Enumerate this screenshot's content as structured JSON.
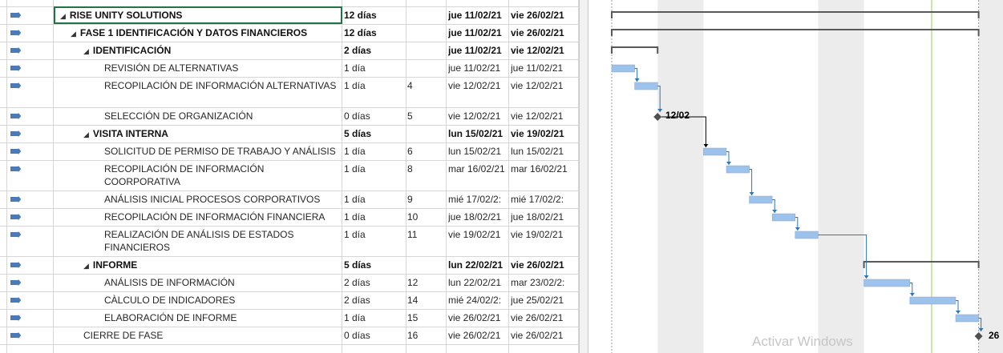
{
  "tasks": [
    {
      "name": "RISE UNITY SOLUTIONS",
      "dur": "12 días",
      "pred": "",
      "start": "jue 11/02/21",
      "end": "vie 26/02/21",
      "level": 0,
      "summary": true
    },
    {
      "name": "FASE 1 IDENTIFICACIÓN Y DATOS FINANCIEROS",
      "dur": "12 días",
      "pred": "",
      "start": "jue 11/02/21",
      "end": "vie 26/02/21",
      "level": 1,
      "summary": true
    },
    {
      "name": "IDENTIFICACIÓN",
      "dur": "2 días",
      "pred": "",
      "start": "jue 11/02/21",
      "end": "vie 12/02/21",
      "level": 2,
      "summary": true
    },
    {
      "name": "REVISIÓN DE ALTERNATIVAS",
      "dur": "1 día",
      "pred": "",
      "start": "jue 11/02/21",
      "end": "jue 11/02/21",
      "level": 3,
      "summary": false
    },
    {
      "name": "RECOPILACIÓN DE INFORMACIÓN ALTERNATIVAS",
      "dur": "1 día",
      "pred": "4",
      "start": "vie 12/02/21",
      "end": "vie 12/02/21",
      "level": 3,
      "summary": false
    },
    {
      "name": "SELECCIÓN DE ORGANIZACIÓN",
      "dur": "0 días",
      "pred": "5",
      "start": "vie 12/02/21",
      "end": "vie 12/02/21",
      "level": 3,
      "summary": false
    },
    {
      "name": "VISITA INTERNA",
      "dur": "5 días",
      "pred": "",
      "start": "lun 15/02/21",
      "end": "vie 19/02/21",
      "level": 2,
      "summary": true
    },
    {
      "name": "SOLICITUD DE PERMISO DE TRABAJO Y ANÁLISIS",
      "dur": "1 día",
      "pred": "6",
      "start": "lun 15/02/21",
      "end": "lun 15/02/21",
      "level": 3,
      "summary": false
    },
    {
      "name": "RECOPILACIÓN DE INFORMACIÓN COORPORATIVA",
      "dur": "1 día",
      "pred": "8",
      "start": "mar 16/02/21",
      "end": "mar 16/02/21",
      "level": 3,
      "summary": false
    },
    {
      "name": "ANÁLISIS INICIAL PROCESOS CORPORATIVOS",
      "dur": "1 día",
      "pred": "9",
      "start": "mié 17/02/2:",
      "end": "mié 17/02/2:",
      "level": 3,
      "summary": false
    },
    {
      "name": "RECOPILACIÓN  DE INFORMACIÓN FINANCIERA",
      "dur": "1 día",
      "pred": "10",
      "start": "jue 18/02/21",
      "end": "jue 18/02/21",
      "level": 3,
      "summary": false
    },
    {
      "name": "REALIZACIÓN DE ANÁLISIS DE ESTADOS FINANCIEROS",
      "dur": "1 día",
      "pred": "11",
      "start": "vie 19/02/21",
      "end": "vie 19/02/21",
      "level": 3,
      "summary": false
    },
    {
      "name": "INFORME",
      "dur": "5 días",
      "pred": "",
      "start": "lun 22/02/21",
      "end": "vie 26/02/21",
      "level": 2,
      "summary": true
    },
    {
      "name": "ANÁLISIS DE INFORMACIÓN",
      "dur": "2 días",
      "pred": "12",
      "start": "lun 22/02/21",
      "end": "mar 23/02/2:",
      "level": 3,
      "summary": false
    },
    {
      "name": "CÀLCULO DE INDICADORES",
      "dur": "2 días",
      "pred": "14",
      "start": "mié 24/02/2:",
      "end": "jue 25/02/21",
      "level": 3,
      "summary": false
    },
    {
      "name": "ELABORACIÓN DE INFORME",
      "dur": "1 día",
      "pred": "15",
      "start": "vie 26/02/21",
      "end": "vie 26/02/21",
      "level": 3,
      "summary": false
    },
    {
      "name": "CIERRE DE FASE",
      "dur": "0 días",
      "pred": "16",
      "start": "vie 26/02/21",
      "end": "vie 26/02/21",
      "level": 2,
      "summary": false
    }
  ],
  "chart_data": {
    "type": "gantt",
    "timeline_start": "2021-02-11",
    "timeline_end": "2021-02-26",
    "summaries": [
      {
        "row": 0,
        "start": "2021-02-11",
        "end": "2021-02-26"
      },
      {
        "row": 1,
        "start": "2021-02-11",
        "end": "2021-02-26"
      },
      {
        "row": 2,
        "start": "2021-02-11",
        "end": "2021-02-12"
      },
      {
        "row": 12,
        "start": "2021-02-22",
        "end": "2021-02-26"
      }
    ],
    "bars": [
      {
        "row": 3,
        "start": "2021-02-11",
        "end": "2021-02-11"
      },
      {
        "row": 4,
        "start": "2021-02-12",
        "end": "2021-02-12"
      },
      {
        "row": 7,
        "start": "2021-02-15",
        "end": "2021-02-15"
      },
      {
        "row": 8,
        "start": "2021-02-16",
        "end": "2021-02-16"
      },
      {
        "row": 9,
        "start": "2021-02-17",
        "end": "2021-02-17"
      },
      {
        "row": 10,
        "start": "2021-02-18",
        "end": "2021-02-18"
      },
      {
        "row": 11,
        "start": "2021-02-19",
        "end": "2021-02-19"
      },
      {
        "row": 13,
        "start": "2021-02-22",
        "end": "2021-02-23"
      },
      {
        "row": 14,
        "start": "2021-02-24",
        "end": "2021-02-25"
      },
      {
        "row": 15,
        "start": "2021-02-26",
        "end": "2021-02-26"
      }
    ],
    "milestones": [
      {
        "row": 5,
        "date": "2021-02-12",
        "label": "12/02"
      },
      {
        "row": 16,
        "date": "2021-02-26",
        "label": "26"
      }
    ],
    "links": [
      [
        3,
        4
      ],
      [
        4,
        5
      ],
      [
        5,
        7
      ],
      [
        7,
        8
      ],
      [
        8,
        9
      ],
      [
        9,
        10
      ],
      [
        10,
        11
      ],
      [
        11,
        13
      ],
      [
        13,
        14
      ],
      [
        14,
        15
      ],
      [
        15,
        16
      ]
    ]
  },
  "colors": {
    "task_bar": "#9dc3ec",
    "link": "#2e75b6",
    "summary": "#595959",
    "weekend_shade": "#ececec",
    "status_line": "#92d050",
    "indicator": "#4a7bb7"
  },
  "watermark": "Activar Windows"
}
